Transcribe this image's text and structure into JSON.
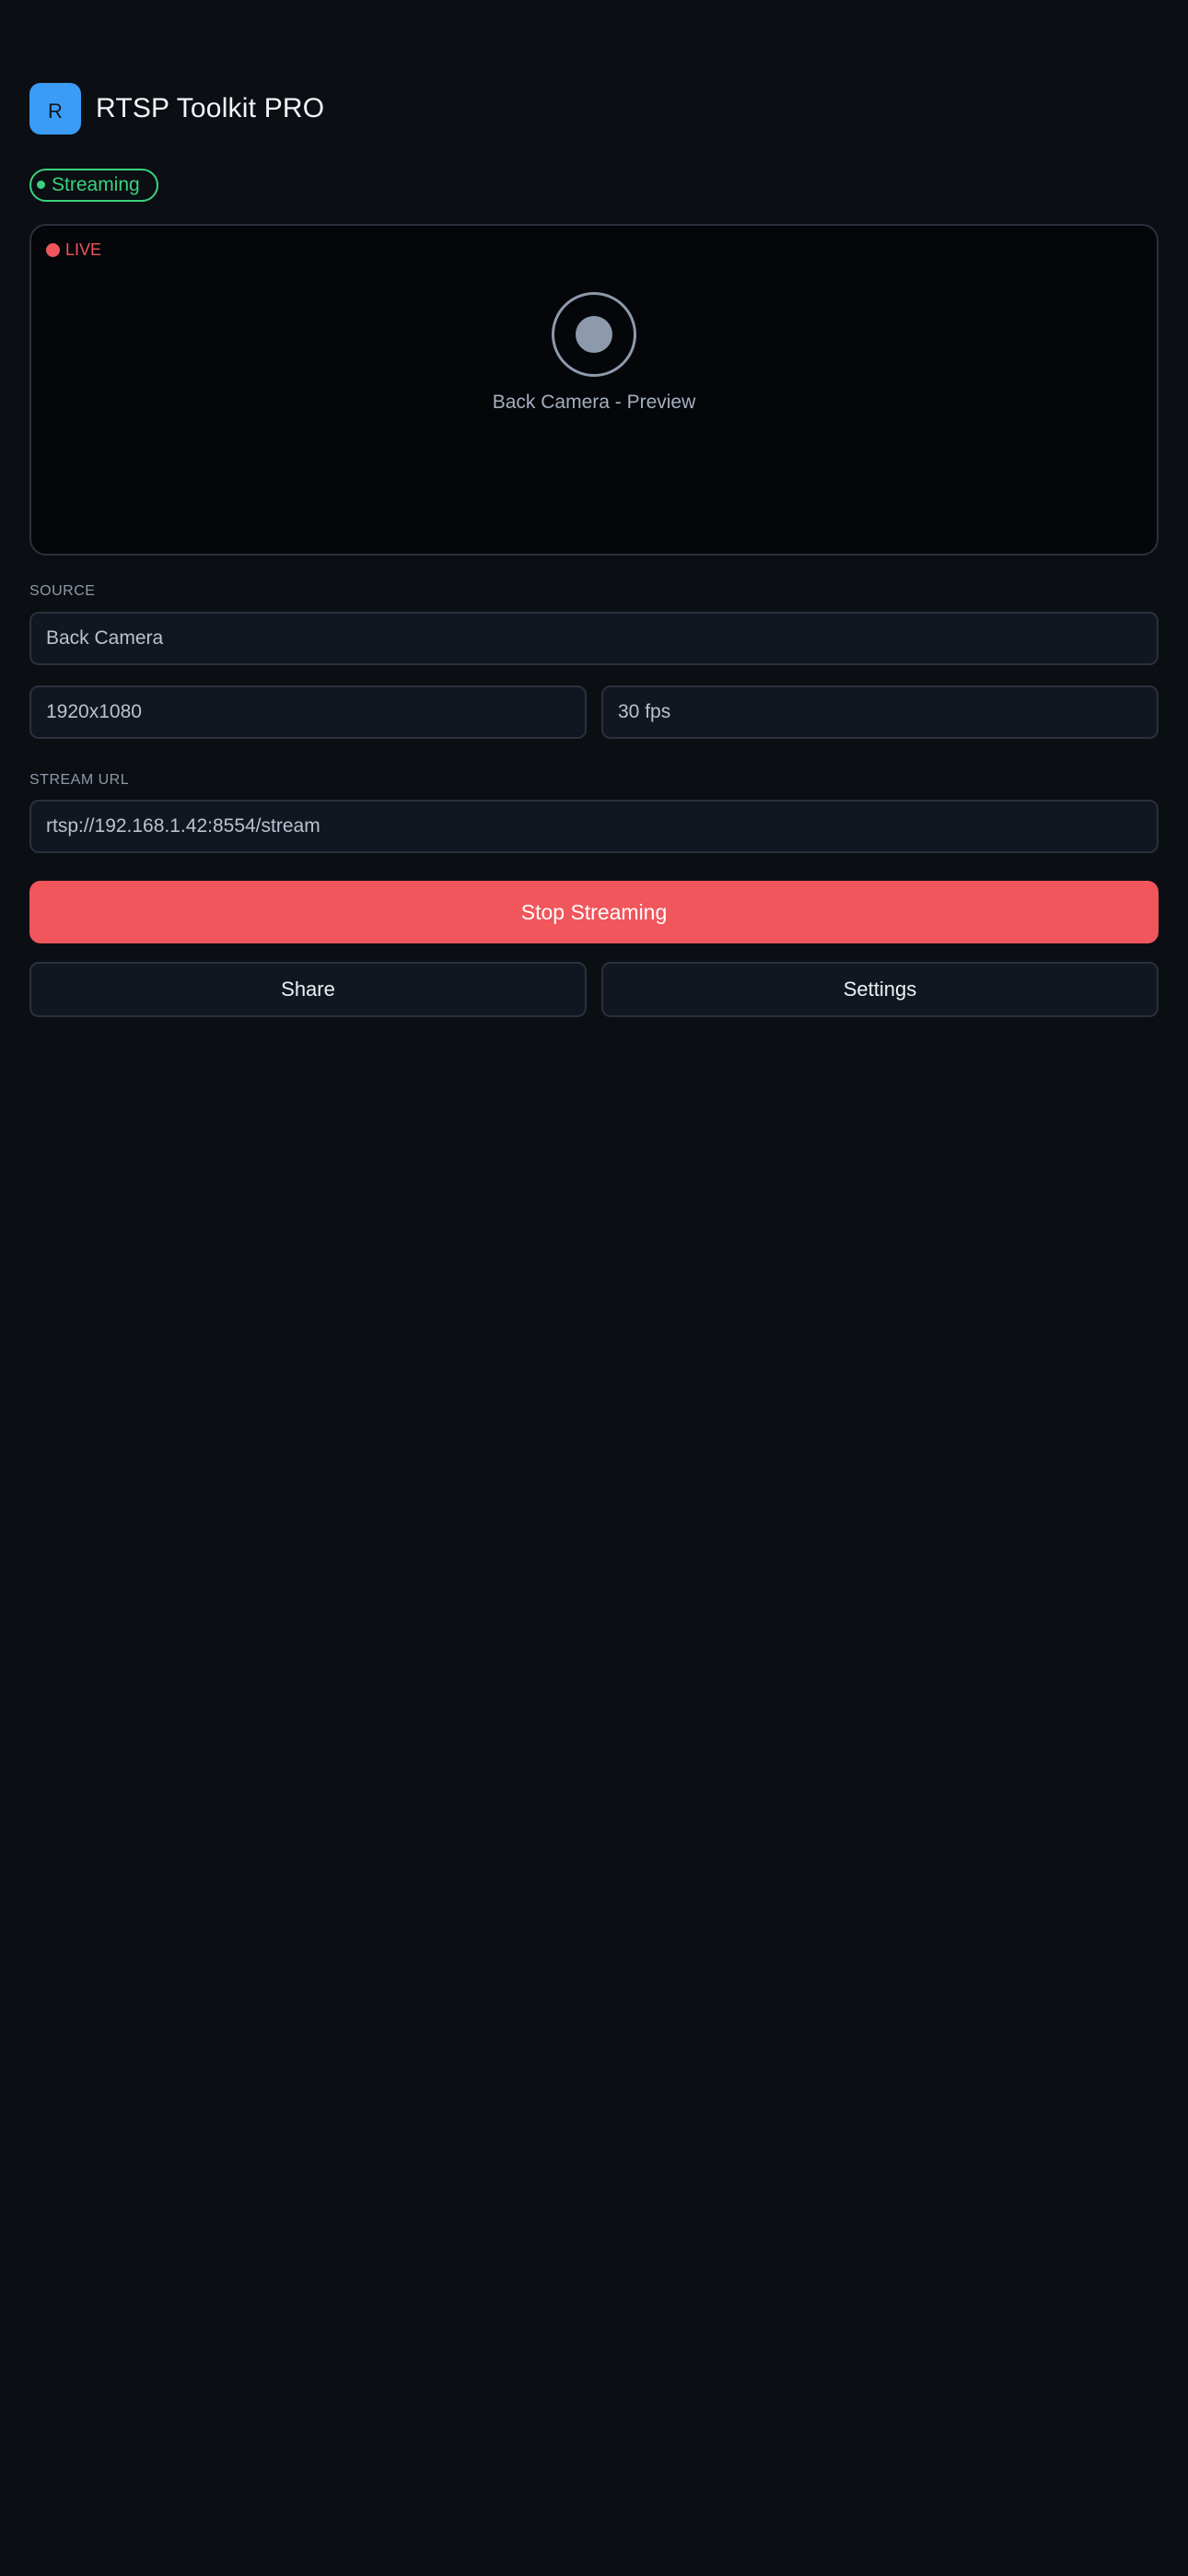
{
  "app": {
    "icon_letter": "R",
    "title": "RTSP Toolkit PRO",
    "brand_color": "#3b9cf5"
  },
  "status": {
    "label": "Streaming",
    "color": "#3ad27e"
  },
  "preview": {
    "live_label": "LIVE",
    "live_color": "#f0555c",
    "icon": "camera-lens-icon",
    "caption": "Back Camera - Preview"
  },
  "source": {
    "section_label": "SOURCE",
    "camera": "Back Camera",
    "resolution": "1920x1080",
    "frame_rate": "30 fps"
  },
  "stream": {
    "section_label": "STREAM URL",
    "url": "rtsp://192.168.1.42:8554/stream"
  },
  "actions": {
    "stop_label": "Stop Streaming",
    "stop_color": "#f0565b",
    "share_label": "Share",
    "settings_label": "Settings"
  }
}
